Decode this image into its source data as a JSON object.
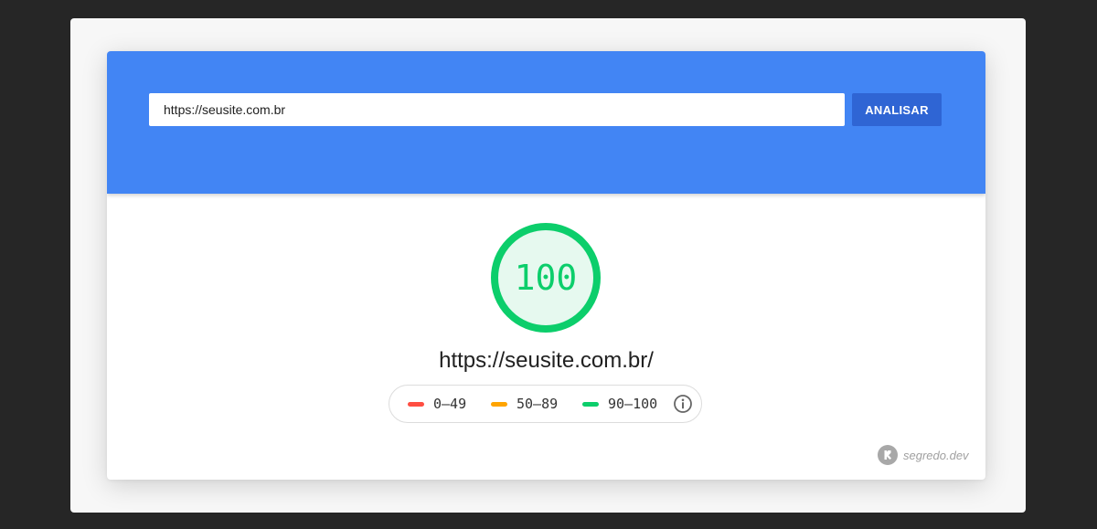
{
  "search": {
    "url_value": "https://seusite.com.br",
    "analyze_label": "ANALISAR"
  },
  "result": {
    "score": "100",
    "score_fraction": 1.0,
    "url": "https://seusite.com.br/"
  },
  "legend": {
    "items": [
      {
        "label": "0–49",
        "color": "#ff4e42"
      },
      {
        "label": "50–89",
        "color": "#ffa400"
      },
      {
        "label": "90–100",
        "color": "#0cce6b"
      }
    ],
    "info_icon": "info-icon"
  },
  "watermark": {
    "text": "segredo.dev",
    "logo_icon": "segredo-logo-icon"
  },
  "colors": {
    "header_blue": "#4285f4",
    "button_blue": "#2f65d4",
    "good_green": "#0cce6b",
    "gauge_fill": "#e6f9ef"
  }
}
